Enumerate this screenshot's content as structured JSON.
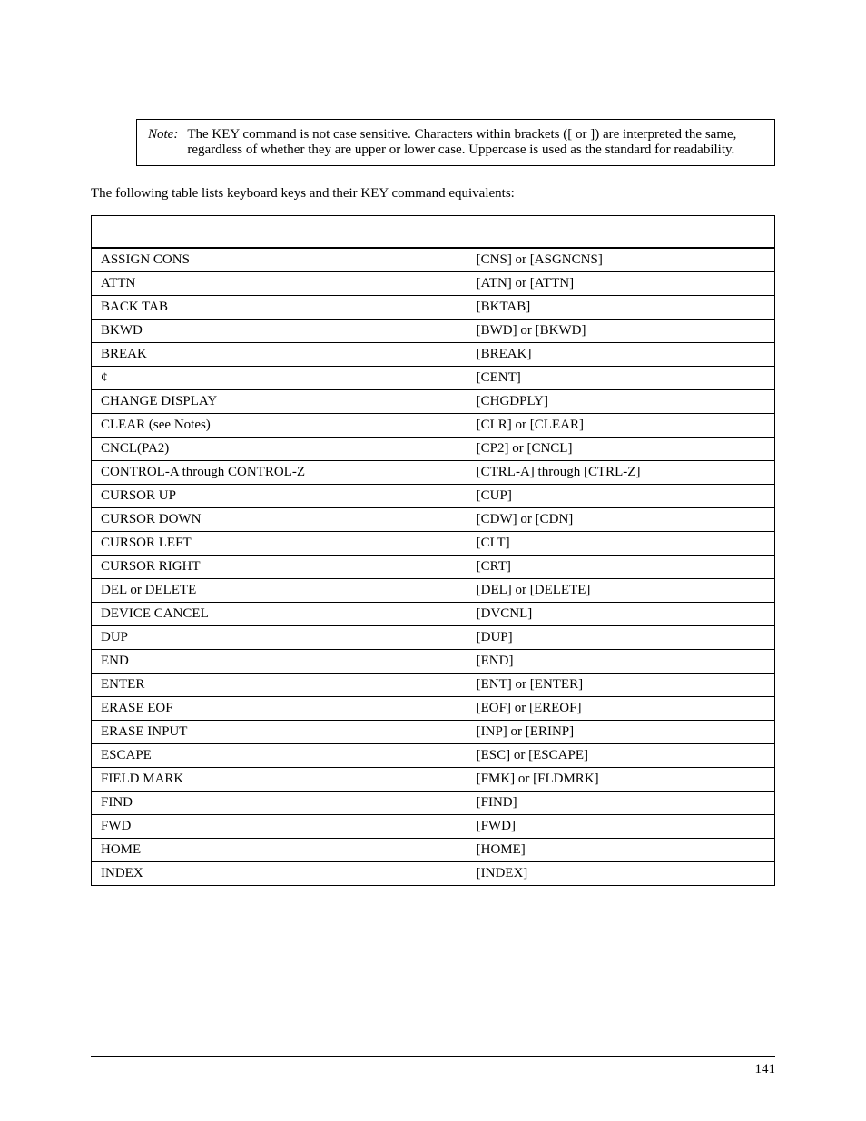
{
  "note": {
    "label": "Note",
    "text": "The KEY command is not case sensitive.  Characters within brackets ([ or ]) are interpreted the same, regardless of whether they are upper or lower case.  Uppercase is used as the standard for readability."
  },
  "intro": "The following table lists keyboard keys and their KEY command equivalents:",
  "table": {
    "header": {
      "col1": "",
      "col2": ""
    },
    "rows": [
      {
        "key": "ASSIGN CONS",
        "cmd": "[CNS] or [ASGNCNS]"
      },
      {
        "key": "ATTN",
        "cmd": "[ATN] or [ATTN]"
      },
      {
        "key": "BACK TAB",
        "cmd": "[BKTAB]"
      },
      {
        "key": "BKWD",
        "cmd": "[BWD] or [BKWD]"
      },
      {
        "key": "BREAK",
        "cmd": "[BREAK]"
      },
      {
        "key": "¢",
        "cmd": "[CENT]"
      },
      {
        "key": "CHANGE DISPLAY",
        "cmd": "[CHGDPLY]"
      },
      {
        "key": "CLEAR (see Notes)",
        "cmd": "[CLR] or [CLEAR]"
      },
      {
        "key": "CNCL(PA2)",
        "cmd": "[CP2] or [CNCL]"
      },
      {
        "key": "CONTROL-A through CONTROL-Z",
        "cmd": "[CTRL-A] through [CTRL-Z]"
      },
      {
        "key": "CURSOR UP",
        "cmd": "[CUP]"
      },
      {
        "key": "CURSOR DOWN",
        "cmd": "[CDW] or [CDN]"
      },
      {
        "key": "CURSOR LEFT",
        "cmd": "[CLT]"
      },
      {
        "key": "CURSOR RIGHT",
        "cmd": "[CRT]"
      },
      {
        "key": "DEL or DELETE",
        "cmd": "[DEL] or [DELETE]"
      },
      {
        "key": "DEVICE CANCEL",
        "cmd": "[DVCNL]"
      },
      {
        "key": "DUP",
        "cmd": "[DUP]"
      },
      {
        "key": "END",
        "cmd": "[END]"
      },
      {
        "key": "ENTER",
        "cmd": "[ENT] or [ENTER]"
      },
      {
        "key": "ERASE EOF",
        "cmd": "[EOF] or [EREOF]"
      },
      {
        "key": "ERASE INPUT",
        "cmd": "[INP] or [ERINP]"
      },
      {
        "key": "ESCAPE",
        "cmd": "[ESC] or [ESCAPE]"
      },
      {
        "key": "FIELD MARK",
        "cmd": "[FMK] or [FLDMRK]"
      },
      {
        "key": "FIND",
        "cmd": "[FIND]"
      },
      {
        "key": "FWD",
        "cmd": "[FWD]"
      },
      {
        "key": "HOME",
        "cmd": "[HOME]"
      },
      {
        "key": "INDEX",
        "cmd": "[INDEX]"
      }
    ]
  },
  "page_number": "141"
}
